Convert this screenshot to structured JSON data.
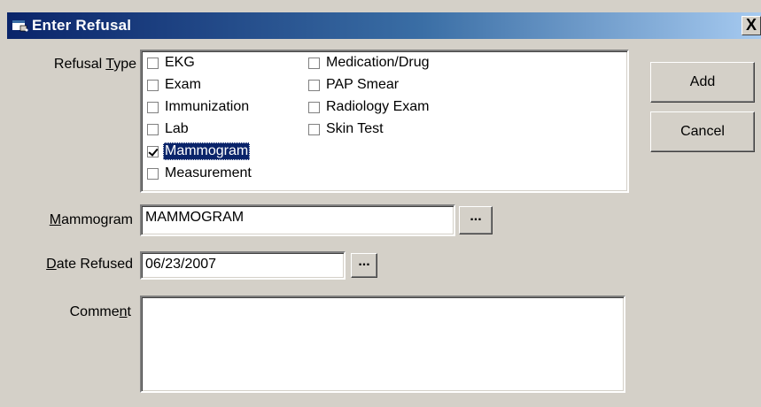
{
  "window": {
    "title": "Enter Refusal",
    "close_glyph": "X"
  },
  "refusal_type": {
    "label_prefix": "Refusal ",
    "label_accel": "T",
    "label_suffix": "ype",
    "items_col1": [
      {
        "label": "EKG",
        "checked": false,
        "selected": false
      },
      {
        "label": "Exam",
        "checked": false,
        "selected": false
      },
      {
        "label": "Immunization",
        "checked": false,
        "selected": false
      },
      {
        "label": "Lab",
        "checked": false,
        "selected": false
      },
      {
        "label": "Mammogram",
        "checked": true,
        "selected": true
      },
      {
        "label": "Measurement",
        "checked": false,
        "selected": false
      }
    ],
    "items_col2": [
      {
        "label": "Medication/Drug",
        "checked": false,
        "selected": false
      },
      {
        "label": "PAP Smear",
        "checked": false,
        "selected": false
      },
      {
        "label": "Radiology Exam",
        "checked": false,
        "selected": false
      },
      {
        "label": "Skin Test",
        "checked": false,
        "selected": false
      }
    ]
  },
  "buttons": {
    "add": "Add",
    "cancel": "Cancel"
  },
  "mammogram": {
    "label_accel": "M",
    "label_rest": "ammogram",
    "value": "MAMMOGRAM",
    "lookup_label": "..."
  },
  "date_refused": {
    "label_accel": "D",
    "label_rest": "ate Refused",
    "value": "06/23/2007",
    "picker_label": "..."
  },
  "comment": {
    "label_prefix": "Comme",
    "label_accel": "n",
    "label_suffix": "t",
    "value": ""
  },
  "colors": {
    "title_gradient_start": "#0a246a",
    "title_gradient_end": "#a6caf0",
    "dialog_face": "#d4d0c8",
    "selection": "#0a246a"
  },
  "icons": {
    "title": "window-app-icon",
    "close": "close-icon",
    "check": "checkmark-icon"
  }
}
